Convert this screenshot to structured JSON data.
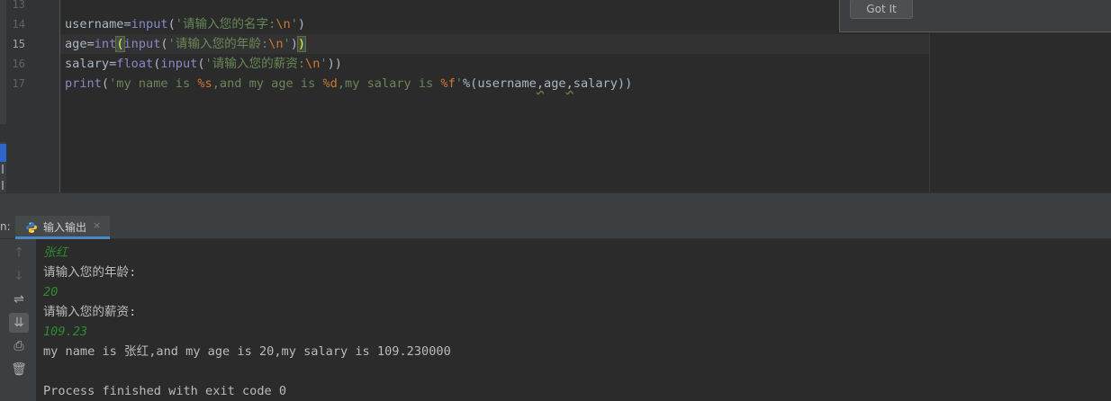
{
  "editor": {
    "line_numbers": [
      {
        "n": "13",
        "current": false
      },
      {
        "n": "14",
        "current": false
      },
      {
        "n": "15",
        "current": true
      },
      {
        "n": "16",
        "current": false
      },
      {
        "n": "17",
        "current": false
      }
    ],
    "code_lines": [
      {
        "segments": []
      },
      {
        "segments": [
          {
            "t": "username",
            "c": "k-id"
          },
          {
            "t": "=",
            "c": "k-op"
          },
          {
            "t": "input",
            "c": "k-bi"
          },
          {
            "t": "(",
            "c": "k-op"
          },
          {
            "t": "'请输入您的名字:",
            "c": "k-str"
          },
          {
            "t": "\\n",
            "c": "k-esc"
          },
          {
            "t": "'",
            "c": "k-str"
          },
          {
            "t": ")",
            "c": "k-op"
          }
        ]
      },
      {
        "segments": [
          {
            "t": "age",
            "c": "k-id"
          },
          {
            "t": "=",
            "c": "k-op"
          },
          {
            "t": "int",
            "c": "k-bi"
          },
          {
            "t": "(",
            "c": "brace-hl"
          },
          {
            "t": "input",
            "c": "k-bi"
          },
          {
            "t": "(",
            "c": "k-op"
          },
          {
            "t": "'请输入您的年龄:",
            "c": "k-str"
          },
          {
            "t": "\\n",
            "c": "k-esc"
          },
          {
            "t": "'",
            "c": "k-str"
          },
          {
            "t": ")",
            "c": "k-op"
          },
          {
            "t": ")",
            "c": "brace-hl"
          }
        ]
      },
      {
        "segments": [
          {
            "t": "salary",
            "c": "k-id"
          },
          {
            "t": "=",
            "c": "k-op"
          },
          {
            "t": "float",
            "c": "k-bi"
          },
          {
            "t": "(",
            "c": "k-op"
          },
          {
            "t": "input",
            "c": "k-bi"
          },
          {
            "t": "(",
            "c": "k-op"
          },
          {
            "t": "'请输入您的薪资:",
            "c": "k-str"
          },
          {
            "t": "\\n",
            "c": "k-esc"
          },
          {
            "t": "'",
            "c": "k-str"
          },
          {
            "t": "))",
            "c": "k-op"
          }
        ]
      },
      {
        "segments": [
          {
            "t": "print",
            "c": "k-bi"
          },
          {
            "t": "(",
            "c": "k-op"
          },
          {
            "t": "'my name is ",
            "c": "k-str"
          },
          {
            "t": "%s",
            "c": "k-fmt"
          },
          {
            "t": ",and my age is ",
            "c": "k-str"
          },
          {
            "t": "%d",
            "c": "k-fmt"
          },
          {
            "t": ",my salary is ",
            "c": "k-str"
          },
          {
            "t": "%f",
            "c": "k-fmt"
          },
          {
            "t": "'",
            "c": "k-str"
          },
          {
            "t": "%",
            "c": "k-op"
          },
          {
            "t": "(username",
            "c": "k-id"
          },
          {
            "t": ",",
            "c": "k-op wavy"
          },
          {
            "t": "age",
            "c": "k-id"
          },
          {
            "t": ",",
            "c": "k-op wavy"
          },
          {
            "t": "salary))",
            "c": "k-id"
          }
        ]
      }
    ]
  },
  "tooltip": {
    "got_it_label": "Got It"
  },
  "run_panel": {
    "side_label": "n:",
    "tab_label": "输入输出",
    "close_glyph": "×"
  },
  "console": {
    "toolbar": [
      {
        "name": "scroll-up-icon",
        "glyph": "↑",
        "dim": true,
        "active": false
      },
      {
        "name": "scroll-down-icon",
        "glyph": "↓",
        "dim": true,
        "active": false
      },
      {
        "name": "soft-wrap-icon",
        "glyph": "⇌",
        "dim": false,
        "active": false
      },
      {
        "name": "scroll-to-end-icon",
        "glyph": "⇊",
        "dim": false,
        "active": true
      },
      {
        "name": "print-icon",
        "glyph": "⎙",
        "dim": false,
        "active": false
      },
      {
        "name": "trash-icon",
        "glyph": "🗑",
        "dim": false,
        "active": false
      }
    ],
    "lines": [
      {
        "text": "张红",
        "kind": "c-in"
      },
      {
        "text": "请输入您的年龄:",
        "kind": "c-out"
      },
      {
        "text": "20",
        "kind": "c-in"
      },
      {
        "text": "请输入您的薪资:",
        "kind": "c-out"
      },
      {
        "text": "109.23",
        "kind": "c-in"
      },
      {
        "text": "my name is 张红,and my age is 20,my salary is 109.230000",
        "kind": "c-out"
      },
      {
        "text": "",
        "kind": "c-out"
      },
      {
        "text": "Process finished with exit code 0",
        "kind": "c-out"
      }
    ]
  },
  "colors": {
    "editor_bg": "#2b2b2b",
    "panel_bg": "#3c3f41",
    "string": "#6a8759",
    "builtin": "#8888c6",
    "keyword_escape": "#cc7832",
    "user_input": "#2e8b2e",
    "tab_underline": "#4a88c7"
  }
}
